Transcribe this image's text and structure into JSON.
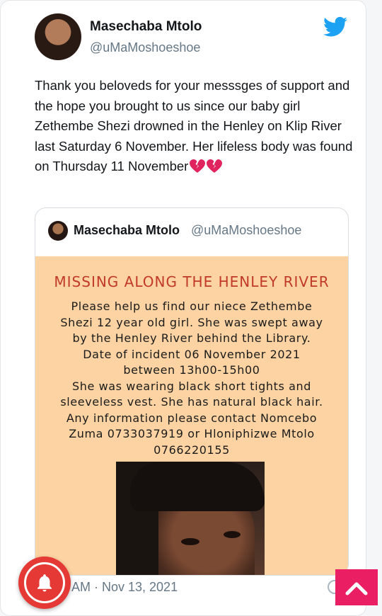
{
  "author": {
    "name": "Masechaba Mtolo",
    "handle": "@uMaMoshoeshoe"
  },
  "tweet": {
    "text": "Thank you beloveds for your messsges of support and the hope you brought to us since our baby girl Zethembe Shezi drowned in the Henley on Klip River last Saturday 6 November. Her lifeless body was found on Thursday 11 November",
    "emoji": "broken-heart-icon x2"
  },
  "quoted": {
    "name": "Masechaba Mtolo",
    "handle": "@uMaMoshoeshoe",
    "poster": {
      "title": "MISSING ALONG THE HENLEY RIVER",
      "lines": [
        "Please help us find our niece Zethembe",
        "Shezi 12 year old girl. She was swept away",
        "by the Henley River behind the Library.",
        "Date of incident 06 November 2021",
        "between 13h00-15h00",
        "She was wearing black short tights and",
        "sleeveless vest. She has natural black hair.",
        "Any information please contact Nomcebo",
        "Zuma 0733037919 or Hloniphizwe Mtolo",
        "0766220155"
      ]
    }
  },
  "meta": {
    "timestamp": "AM · Nov 13, 2021"
  },
  "colors": {
    "poster_bg": "#fdd3a3",
    "title_red": "#c0392b",
    "twitter_blue": "#1da1f2",
    "bell_red": "#e53935",
    "scroll_pink": "#e91e63"
  }
}
